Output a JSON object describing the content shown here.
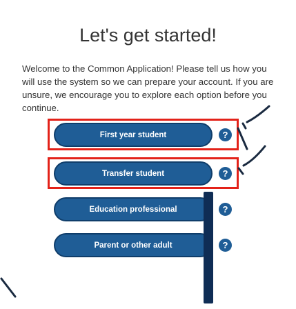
{
  "page": {
    "title": "Let's get started!",
    "intro": "Welcome to the Common Application! Please tell us how you will use the system so we can prepare your account. If you are unsure, we encourage you to explore each option before you continue."
  },
  "options": [
    {
      "label": "First year student",
      "help_icon": "question-circle-icon"
    },
    {
      "label": "Transfer student",
      "help_icon": "question-circle-icon"
    },
    {
      "label": "Education professional",
      "help_icon": "question-circle-icon"
    },
    {
      "label": "Parent or other adult",
      "help_icon": "question-circle-icon"
    }
  ],
  "help_glyph": "?",
  "colors": {
    "button": "#1f5d96",
    "button_border": "#0f3d6a",
    "highlight": "#e32219",
    "marker": "#0f2d55"
  }
}
